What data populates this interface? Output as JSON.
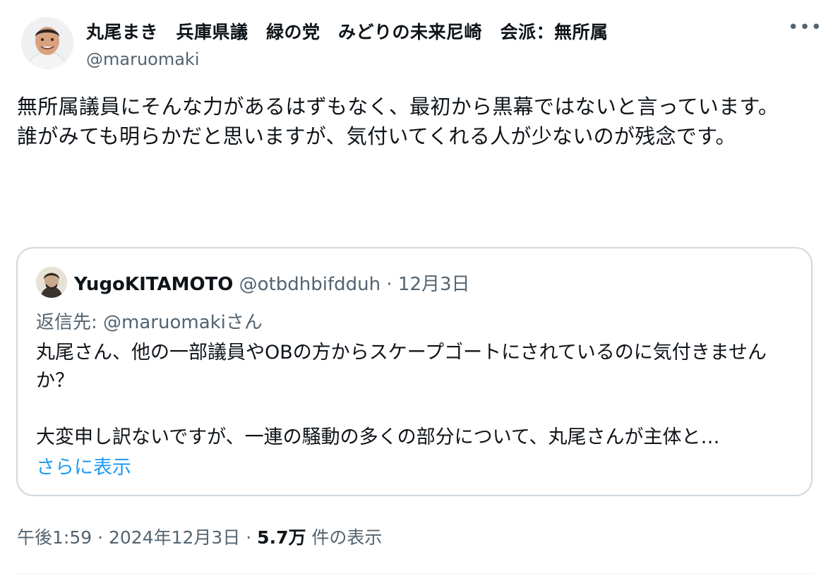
{
  "author": {
    "display_name": "丸尾まき　兵庫県議　緑の党　みどりの未来尼崎　会派：無所属",
    "handle": "@maruomaki",
    "more_icon": "more-horizontal-icon",
    "more_label": "•••"
  },
  "tweet": {
    "text": "無所属議員にそんな力があるはずもなく、最初から黒幕ではないと言っています。\n誰がみても明らかだと思いますが、気付いてくれる人が少ないのが残念です。"
  },
  "quote": {
    "name": "YugoKITAMOTO",
    "handle": "@otbdhbifdduh",
    "separator": " · ",
    "date": "12月3日",
    "reply_prefix": "返信先: ",
    "reply_to": "@maruomakiさん",
    "text": "丸尾さん、他の一部議員やOBの方からスケープゴートにされているのに気付きませんか？\n\n大変申し訳ないですが、一連の騒動の多くの部分について、丸尾さんが主体と…",
    "show_more": "さらに表示"
  },
  "footer": {
    "time": "午後1:59",
    "separator": " · ",
    "date": "2024年12月3日",
    "views_count": "5.7万",
    "views_label": " 件の表示"
  },
  "colors": {
    "text": "#0f1419",
    "secondary": "#536471",
    "link": "#1d9bf0",
    "border": "#cfd9de"
  }
}
